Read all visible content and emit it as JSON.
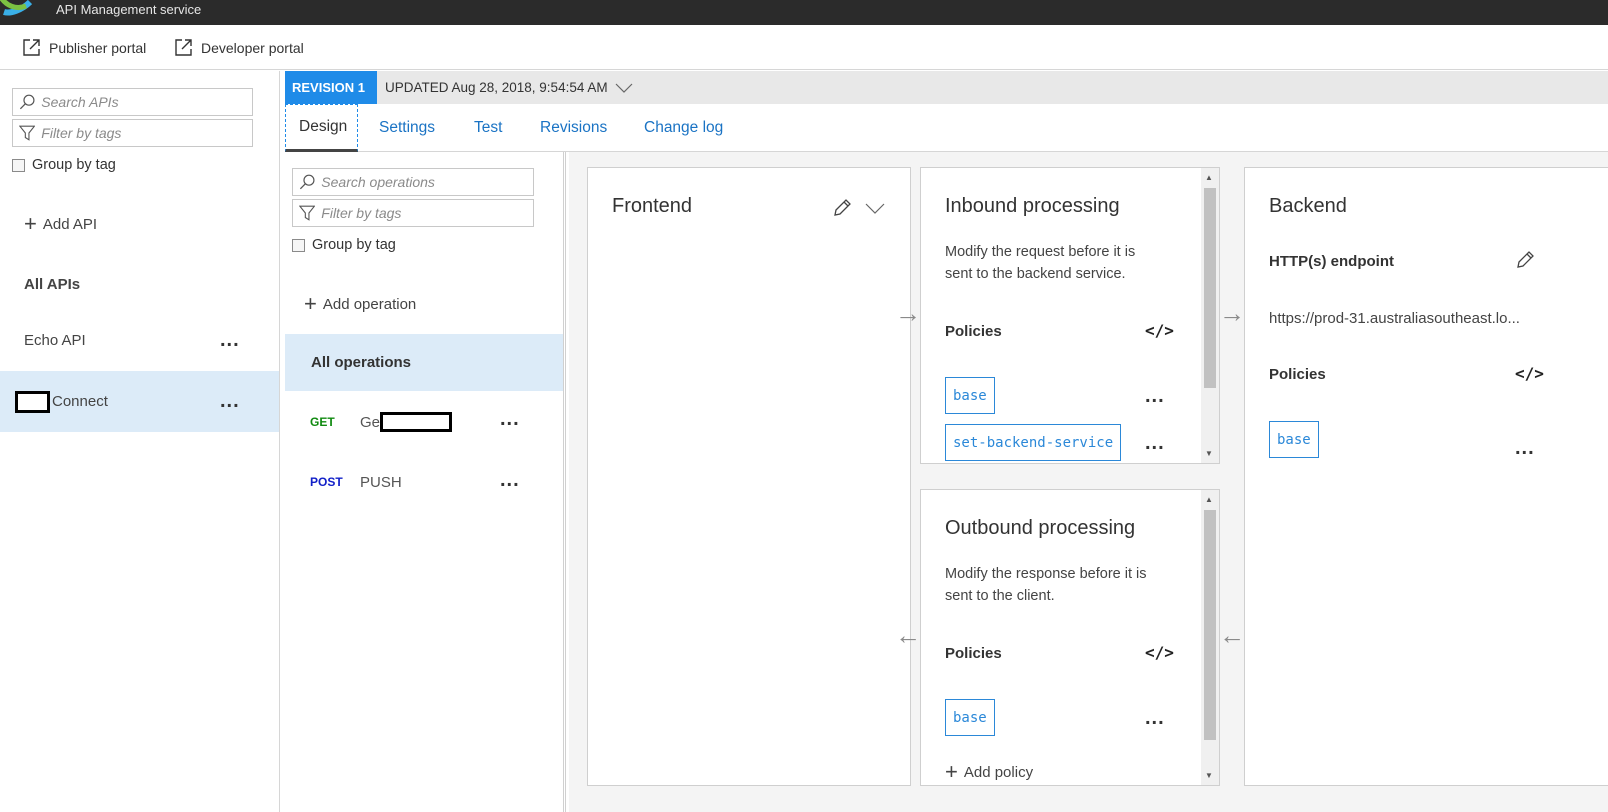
{
  "app": {
    "subtitle": "API Management service"
  },
  "portals": {
    "publisher": "Publisher portal",
    "developer": "Developer portal"
  },
  "api_list": {
    "search_placeholder": "Search APIs",
    "filter_placeholder": "Filter by tags",
    "group_by_tag": "Group by tag",
    "add_api": "Add API",
    "section_title": "All APIs",
    "items": [
      {
        "name": "Echo API"
      },
      {
        "name": "Connect"
      }
    ]
  },
  "revision": {
    "badge": "REVISION 1",
    "updated": "UPDATED Aug 28, 2018, 9:54:54 AM"
  },
  "tabs": [
    {
      "label": "Design"
    },
    {
      "label": "Settings"
    },
    {
      "label": "Test"
    },
    {
      "label": "Revisions"
    },
    {
      "label": "Change log"
    }
  ],
  "operations": {
    "search_placeholder": "Search operations",
    "filter_placeholder": "Filter by tags",
    "group_by_tag": "Group by tag",
    "add_operation": "Add operation",
    "all_label": "All operations",
    "items": [
      {
        "verb": "GET",
        "name": "Ge"
      },
      {
        "verb": "POST",
        "name": "PUSH"
      }
    ]
  },
  "frontend": {
    "title": "Frontend"
  },
  "inbound": {
    "title": "Inbound processing",
    "desc_line1": "Modify the request before it is",
    "desc_line2": "sent to the backend service.",
    "policies_label": "Policies",
    "code_icon": "</>",
    "policies": [
      "base",
      "set-backend-service"
    ]
  },
  "outbound": {
    "title": "Outbound processing",
    "desc_line1": "Modify the response before it is",
    "desc_line2": "sent to the client.",
    "policies_label": "Policies",
    "code_icon": "</>",
    "policies": [
      "base"
    ],
    "add_policy": "Add policy"
  },
  "backend": {
    "title": "Backend",
    "endpoint_label": "HTTP(s) endpoint",
    "endpoint_url": "https://prod-31.australiasoutheast.lo...",
    "policies_label": "Policies",
    "code_icon": "</>",
    "policies": [
      "base"
    ]
  },
  "more_glyph": "...",
  "colors": {
    "accent": "#1f8be8",
    "selected_bg": "#dcebf8",
    "link": "#1a73c4",
    "get_verb": "#108a10",
    "post_verb": "#1220c8",
    "policy_chip": "#2b88d8"
  }
}
